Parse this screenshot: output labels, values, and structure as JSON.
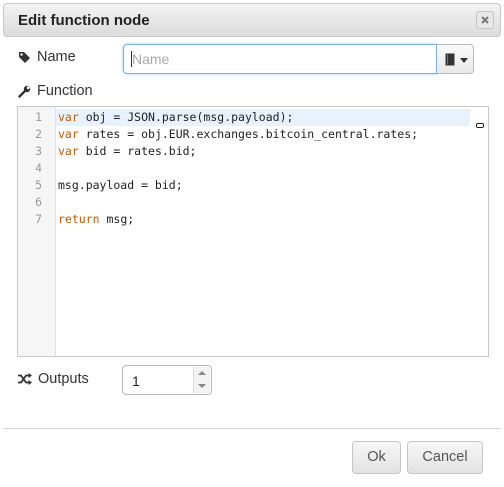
{
  "dialog": {
    "title": "Edit function node",
    "close_icon": "close-icon"
  },
  "name_field": {
    "label": "Name",
    "label_icon": "tag-icon",
    "value": "",
    "placeholder": "Name",
    "icon_picker": "book-icon"
  },
  "function_field": {
    "label": "Function",
    "label_icon": "wrench-icon",
    "lines": [
      {
        "num": "1",
        "kw": "var",
        "rest": " obj = JSON.parse(msg.payload);"
      },
      {
        "num": "2",
        "kw": "var",
        "rest": " rates = obj.EUR.exchanges.bitcoin_central.rates;"
      },
      {
        "num": "3",
        "kw": "var",
        "rest": " bid = rates.bid;"
      },
      {
        "num": "4",
        "kw": "",
        "rest": ""
      },
      {
        "num": "5",
        "kw": "",
        "rest": "msg.payload = bid;"
      },
      {
        "num": "6",
        "kw": "",
        "rest": ""
      },
      {
        "num": "7",
        "kw": "return",
        "rest": " msg;"
      }
    ]
  },
  "outputs_field": {
    "label": "Outputs",
    "label_icon": "shuffle-icon",
    "value": "1"
  },
  "buttons": {
    "ok": "Ok",
    "cancel": "Cancel"
  },
  "colors": {
    "keyword": "#c35a00",
    "focus_border": "#7bb3e0",
    "active_line": "#e8f2ff"
  }
}
